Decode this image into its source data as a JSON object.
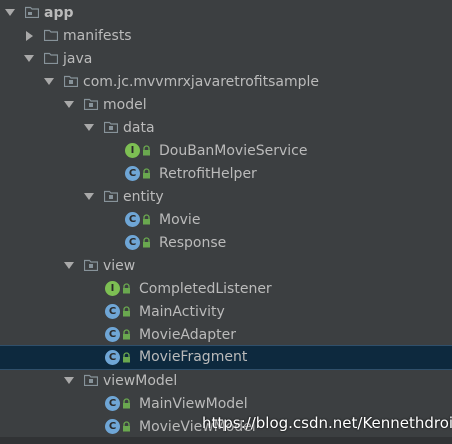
{
  "colors": {
    "background": "#3c3f41",
    "text": "#bbbbbb",
    "selection": "#0d293e",
    "class_icon": "#6fa6d6",
    "interface_icon": "#7dbf53",
    "folder": "#87939a"
  },
  "tree": {
    "app": "app",
    "manifests": "manifests",
    "java": "java",
    "package": "com.jc.mvvmrxjavaretrofitsample",
    "model": "model",
    "data": "data",
    "douban_service": "DouBanMovieService",
    "retrofit_helper": "RetrofitHelper",
    "entity": "entity",
    "movie": "Movie",
    "response": "Response",
    "view": "view",
    "completed_listener": "CompletedListener",
    "main_activity": "MainActivity",
    "movie_adapter": "MovieAdapter",
    "movie_fragment": "MovieFragment",
    "view_model": "viewModel",
    "main_view_model": "MainViewModel",
    "movie_view_model": "MovieViewModel"
  },
  "icons": {
    "class_badge": "C",
    "interface_badge": "I"
  },
  "watermark": "https://blog.csdn.net/Kennethdroid"
}
